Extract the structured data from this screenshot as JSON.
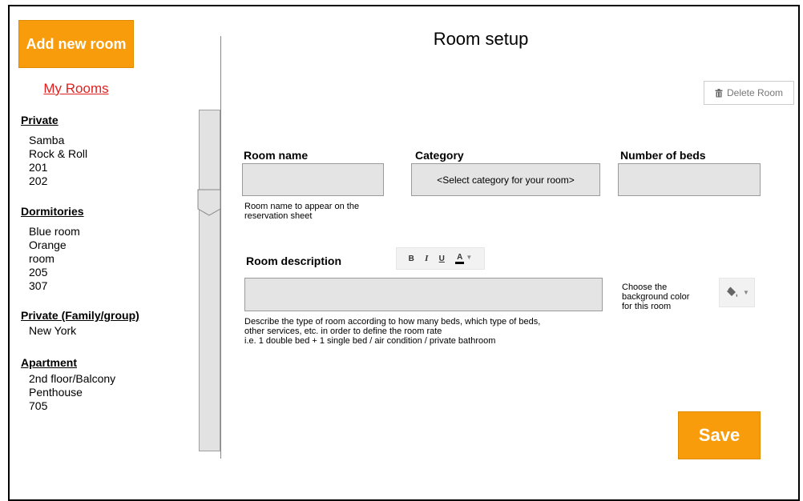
{
  "sidebar": {
    "add_room_label": "Add new room",
    "my_rooms_label": "My Rooms",
    "categories": [
      {
        "title": "Private",
        "rooms": [
          "Samba",
          "Rock & Roll",
          "201",
          "202"
        ]
      },
      {
        "title": "Dormitories",
        "rooms": [
          "Blue room",
          "Orange",
          "room",
          "205",
          "307"
        ]
      },
      {
        "title": "Private (Family/group)",
        "rooms": [
          "New York"
        ]
      },
      {
        "title": "Apartment",
        "rooms": [
          "2nd floor/Balcony",
          "Penthouse",
          "705"
        ]
      }
    ]
  },
  "main": {
    "title": "Room setup",
    "delete_label": "Delete Room",
    "room_name": {
      "label": "Room name",
      "value": "",
      "help": [
        "Room name to appear on the",
        "reservation sheet"
      ]
    },
    "category": {
      "label": "Category",
      "selected": "<Select category for your room>"
    },
    "beds": {
      "label": "Number of beds",
      "value": ""
    },
    "description": {
      "label": "Room description",
      "value": "",
      "help": [
        "Describe the type of room according to how many beds, which type of beds,",
        "other services, etc. in order to define the room rate",
        "i.e. 1 double bed + 1 single bed / air condition / private bathroom"
      ]
    },
    "toolbar": {
      "bold": "B",
      "italic": "I",
      "underline": "U",
      "text_color": "A"
    },
    "bg_color": {
      "label": [
        "Choose the",
        "background color",
        "for  this room"
      ]
    },
    "save_label": "Save"
  },
  "colors": {
    "accent": "#f99c0c",
    "link": "#e02020",
    "field_bg": "#e4e4e4"
  }
}
